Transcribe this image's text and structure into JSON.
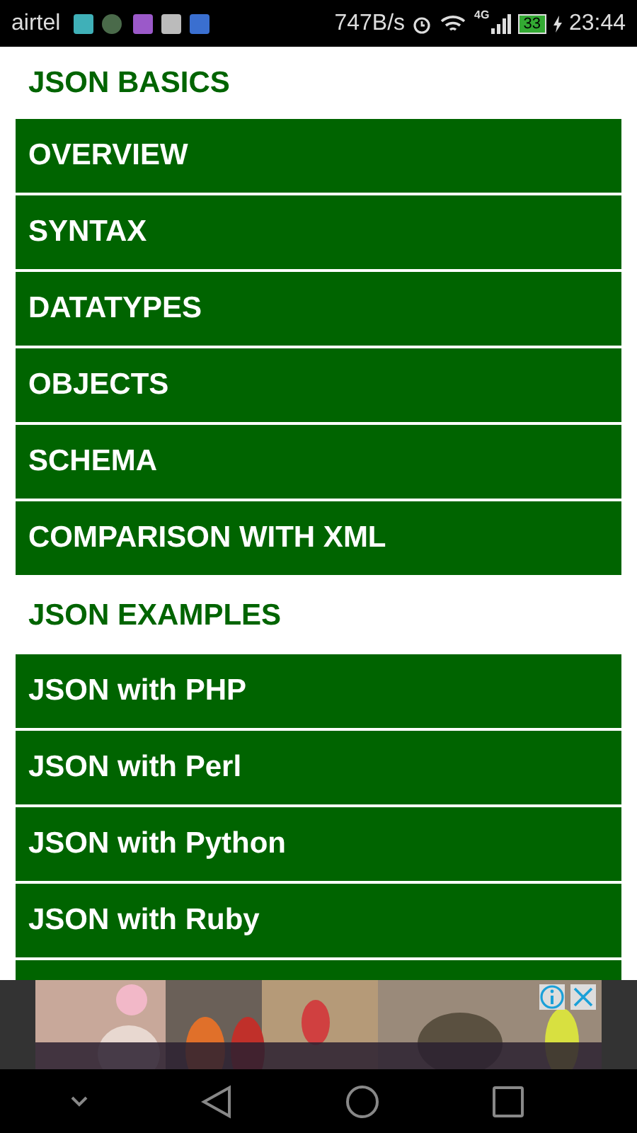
{
  "status_bar": {
    "carrier": "airtel",
    "speed": "747B/s",
    "network": "4G",
    "battery": "33",
    "time": "23:44"
  },
  "sections": [
    {
      "title": "JSON BASICS",
      "items": [
        "OVERVIEW",
        "SYNTAX",
        "DATATYPES",
        "OBJECTS",
        "SCHEMA",
        "COMPARISON WITH XML"
      ]
    },
    {
      "title": "JSON EXAMPLES",
      "items": [
        "JSON with PHP",
        "JSON with Perl",
        "JSON with Python",
        "JSON with Ruby"
      ]
    }
  ]
}
